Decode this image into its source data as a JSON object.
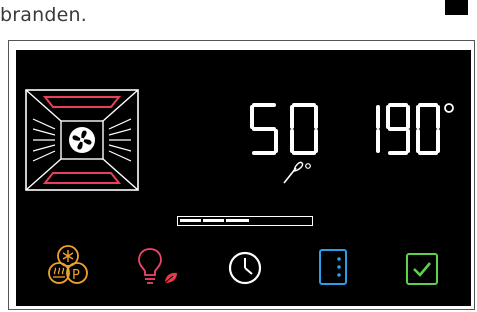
{
  "caption": "branden.",
  "display": {
    "time_value": "50",
    "temperature_value": "190",
    "degree_symbol": "°",
    "probe_unit": "°"
  },
  "progress": {
    "fraction": 0.52
  },
  "icons": {
    "oven": "oven-convection-fan-icon",
    "preset": "snowflake-steam-p-icon",
    "light": "lightbulb-leaf-icon",
    "timer": "clock-icon",
    "door": "door-menu-icon",
    "confirm": "checkmark-icon"
  },
  "colors": {
    "screen_bg": "#000000",
    "segment": "#ffffff",
    "heater_red": "#e8405a",
    "preset_orange": "#f0a22b",
    "light_pink": "#f0456b",
    "leaf_red": "#e83b4a",
    "door_blue": "#2a9fe8",
    "confirm_green": "#5dd14a"
  }
}
